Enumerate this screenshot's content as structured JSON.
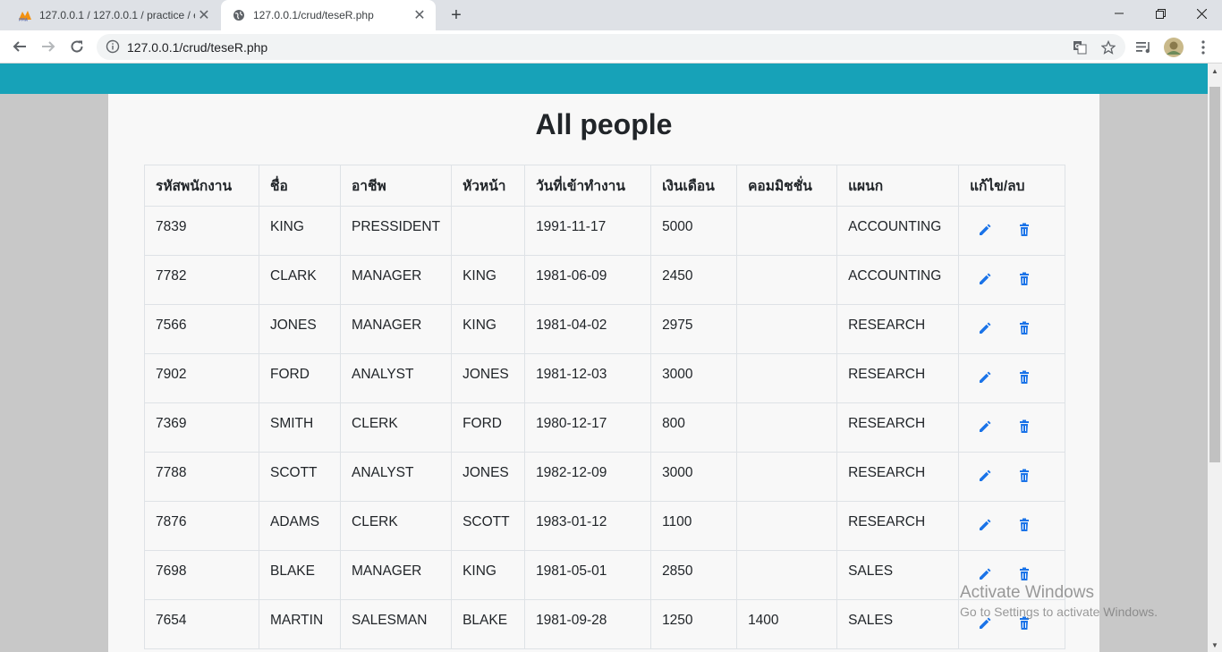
{
  "browser": {
    "tabs": [
      {
        "label": "127.0.0.1 / 127.0.0.1 / practice / e",
        "active": false,
        "icon": "phpmyadmin-icon"
      },
      {
        "label": "127.0.0.1/crud/teseR.php",
        "active": true,
        "icon": "globe-icon"
      }
    ],
    "url": "127.0.0.1/crud/teseR.php"
  },
  "page": {
    "title": "All people",
    "colors": {
      "band": "#17a2b8",
      "card": "#f8f8f8",
      "action_icon": "#1a73e8"
    },
    "table": {
      "headers": [
        "รหัสพนักงาน",
        "ชื่อ",
        "อาชีพ",
        "หัวหน้า",
        "วันที่เข้าทำงาน",
        "เงินเดือน",
        "คอมมิชชั่น",
        "แผนก",
        "แก้ไข/ลบ"
      ],
      "rows": [
        [
          "7839",
          "KING",
          "PRESSIDENT",
          "",
          "1991-11-17",
          "5000",
          "",
          "ACCOUNTING"
        ],
        [
          "7782",
          "CLARK",
          "MANAGER",
          "KING",
          "1981-06-09",
          "2450",
          "",
          "ACCOUNTING"
        ],
        [
          "7566",
          "JONES",
          "MANAGER",
          "KING",
          "1981-04-02",
          "2975",
          "",
          "RESEARCH"
        ],
        [
          "7902",
          "FORD",
          "ANALYST",
          "JONES",
          "1981-12-03",
          "3000",
          "",
          "RESEARCH"
        ],
        [
          "7369",
          "SMITH",
          "CLERK",
          "FORD",
          "1980-12-17",
          "800",
          "",
          "RESEARCH"
        ],
        [
          "7788",
          "SCOTT",
          "ANALYST",
          "JONES",
          "1982-12-09",
          "3000",
          "",
          "RESEARCH"
        ],
        [
          "7876",
          "ADAMS",
          "CLERK",
          "SCOTT",
          "1983-01-12",
          "1100",
          "",
          "RESEARCH"
        ],
        [
          "7698",
          "BLAKE",
          "MANAGER",
          "KING",
          "1981-05-01",
          "2850",
          "",
          "SALES"
        ],
        [
          "7654",
          "MARTIN",
          "SALESMAN",
          "BLAKE",
          "1981-09-28",
          "1250",
          "1400",
          "SALES"
        ]
      ]
    }
  },
  "watermark": {
    "line1": "Activate Windows",
    "line2": "Go to Settings to activate Windows."
  }
}
